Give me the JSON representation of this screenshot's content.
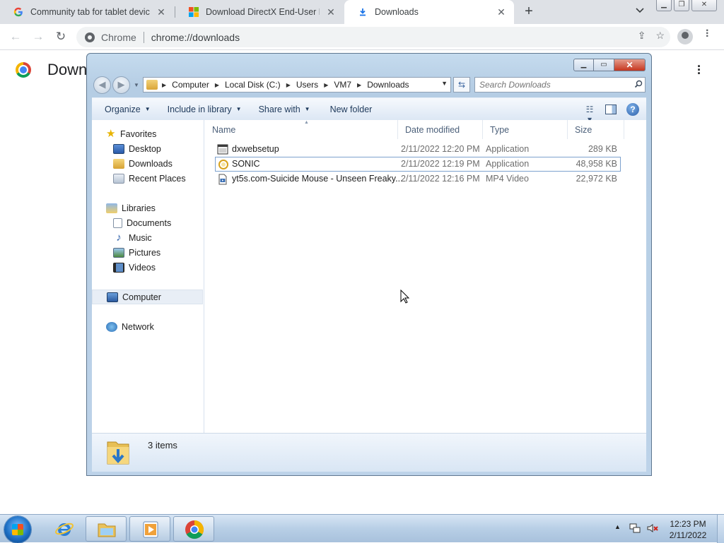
{
  "browser": {
    "tabs": [
      {
        "title": "Community tab for tablet devices",
        "favicon": "google-g-icon",
        "active": false
      },
      {
        "title": "Download DirectX End-User Runtime",
        "favicon": "microsoft-logo-icon",
        "active": false
      },
      {
        "title": "Downloads",
        "favicon": "download-icon",
        "active": true
      }
    ],
    "new_tab_label": "+",
    "omnibox": {
      "scheme_label": "Chrome",
      "url": "chrome://downloads"
    }
  },
  "downloads_page": {
    "title": "Downloads"
  },
  "explorer": {
    "breadcrumb": [
      "Computer",
      "Local Disk (C:)",
      "Users",
      "VM7",
      "Downloads"
    ],
    "search_placeholder": "Search Downloads",
    "commands": [
      {
        "label": "Organize",
        "has_dropdown": true
      },
      {
        "label": "Include in library",
        "has_dropdown": true
      },
      {
        "label": "Share with",
        "has_dropdown": true
      },
      {
        "label": "New folder",
        "has_dropdown": false
      }
    ],
    "nav": {
      "favorites": {
        "label": "Favorites",
        "items": [
          "Desktop",
          "Downloads",
          "Recent Places"
        ]
      },
      "libraries": {
        "label": "Libraries",
        "items": [
          "Documents",
          "Music",
          "Pictures",
          "Videos"
        ]
      },
      "computer": "Computer",
      "network": "Network"
    },
    "columns": [
      "Name",
      "Date modified",
      "Type",
      "Size"
    ],
    "files": [
      {
        "name": "dxwebsetup",
        "date": "2/11/2022 12:20 PM",
        "type": "Application",
        "size": "289 KB",
        "icon": "installer-icon"
      },
      {
        "name": "SONIC",
        "date": "2/11/2022 12:19 PM",
        "type": "Application",
        "size": "48,958 KB",
        "icon": "sonic-app-icon"
      },
      {
        "name": "yt5s.com-Suicide Mouse - Unseen Freaky...",
        "date": "2/11/2022 12:16 PM",
        "type": "MP4 Video",
        "size": "22,972 KB",
        "icon": "video-file-icon"
      }
    ],
    "status": {
      "items_count": "3 items"
    }
  },
  "taskbar": {
    "clock_time": "12:23 PM",
    "clock_date": "2/11/2022"
  }
}
